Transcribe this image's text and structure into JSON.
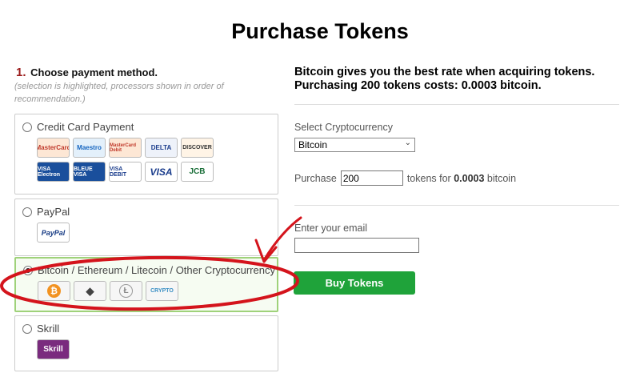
{
  "page": {
    "title": "Purchase Tokens"
  },
  "step": {
    "number": "1.",
    "label": "Choose payment method.",
    "note": "(selection is highlighted, processors shown in order of recommendation.)"
  },
  "methods": [
    {
      "label": "Credit Card Payment",
      "selected": false,
      "logos": [
        {
          "text": "MasterCard",
          "icon": "mastercard-icon"
        },
        {
          "text": "Maestro",
          "icon": "maestro-icon"
        },
        {
          "text": "MasterCard Debit",
          "icon": "mastercard-debit-icon"
        },
        {
          "text": "DELTA",
          "icon": "delta-icon"
        },
        {
          "text": "DISCOVER",
          "icon": "discover-icon"
        },
        {
          "text": "VISA Electron",
          "icon": "visa-electron-icon"
        },
        {
          "text": "BLEUE VISA",
          "icon": "carte-bleue-icon"
        },
        {
          "text": "VISA DEBIT",
          "icon": "visa-debit-icon"
        },
        {
          "text": "VISA",
          "icon": "visa-icon"
        },
        {
          "text": "JCB",
          "icon": "jcb-icon"
        }
      ]
    },
    {
      "label": "PayPal",
      "selected": false,
      "logos": [
        {
          "text": "PayPal",
          "icon": "paypal-icon"
        }
      ]
    },
    {
      "label": "Bitcoin / Ethereum / Litecoin / Other Cryptocurrency",
      "selected": true,
      "logos": [
        {
          "text": "₿",
          "icon": "bitcoin-icon"
        },
        {
          "text": "◆",
          "icon": "ethereum-icon"
        },
        {
          "text": "Ł",
          "icon": "litecoin-icon"
        },
        {
          "text": "CRYPTO",
          "icon": "crypto-icon"
        }
      ]
    },
    {
      "label": "Skrill",
      "selected": false,
      "logos": [
        {
          "text": "Skrill",
          "icon": "skrill-icon"
        }
      ]
    }
  ],
  "right": {
    "heading_line1": "Bitcoin gives you the best rate when acquiring tokens.",
    "heading_line2": "Purchasing 200 tokens costs: 0.0003 bitcoin.",
    "select_label": "Select Cryptocurrency",
    "select_value": "Bitcoin",
    "purchase_prefix": "Purchase",
    "purchase_qty": "200",
    "purchase_mid": "tokens for",
    "purchase_amount": "0.0003",
    "purchase_suffix": "bitcoin",
    "email_label": "Enter your email",
    "email_value": "",
    "buy_label": "Buy Tokens"
  },
  "colors": {
    "accent_green": "#1fa33a",
    "selected_border": "#9fd27a",
    "annotation_red": "#d4141c",
    "step_number": "#9b1b1b"
  }
}
